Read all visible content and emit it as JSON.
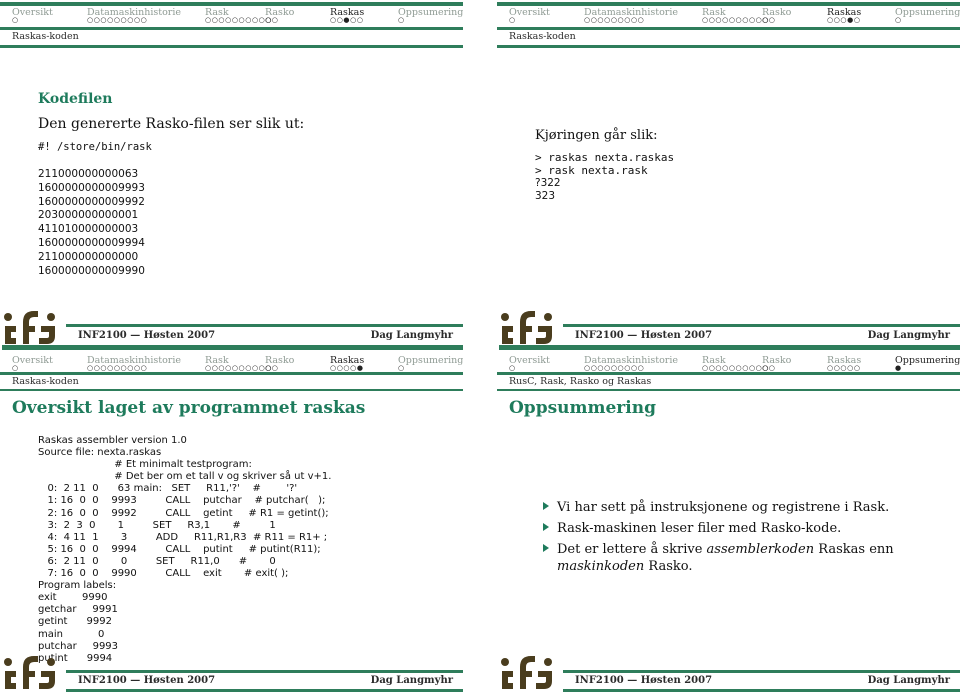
{
  "nav": {
    "sections": [
      {
        "label": "Oversikt",
        "dots": "○"
      },
      {
        "label": "Datamaskinhistorie",
        "dots": "○○○○○○○○○"
      },
      {
        "label": "Rask",
        "dots": "○○○○○○○○○○"
      },
      {
        "label": "Rasko",
        "dots": "○○"
      },
      {
        "label": "Raskas",
        "dots": "○○○○○"
      },
      {
        "label": "Oppsumering",
        "dots": "○"
      }
    ]
  },
  "footer": {
    "course": "INF2100 — Høsten 2007",
    "author": "Dag Langmyhr"
  },
  "slides": [
    {
      "subsection": "Raskas-koden",
      "active_section": "Raskas",
      "dots": [
        "○",
        "○○○○○○○○○",
        "○○○○○○○○○○",
        "○○",
        "○○●○○",
        "○"
      ],
      "block_title": "Kodefilen",
      "intro": "Den genererte Rasko-filen ser slik ut:",
      "shebang": "#! /store/bin/rask",
      "lines": [
        "211000000000063",
        "1600000000009993",
        "1600000000009992",
        "203000000000001",
        "411010000000003",
        "1600000000009994",
        "211000000000000",
        "1600000000009990"
      ]
    },
    {
      "subsection": "Raskas-koden",
      "active_section": "Raskas",
      "dots": [
        "○",
        "○○○○○○○○○",
        "○○○○○○○○○○",
        "○○",
        "○○○●○",
        "○"
      ],
      "intro": "Kjøringen går slik:",
      "terminal": [
        "> raskas nexta.raskas",
        "> rask nexta.rask"
      ],
      "output": [
        "?322",
        "323"
      ]
    },
    {
      "subsection": "Raskas-koden",
      "active_section": "Raskas",
      "dots": [
        "○",
        "○○○○○○○○○",
        "○○○○○○○○○○",
        "○○",
        "○○○○●",
        "○"
      ],
      "frame_title": "Oversikt laget av programmet raskas",
      "listing": [
        "Raskas assembler version 1.0",
        "Source file: nexta.raskas",
        "                        # Et minimalt testprogram:",
        "                        # Det ber om et tall v og skriver så ut v+1.",
        "   0:  2 11  0      63 main:   SET     R11,'?'    #        '?'",
        "   1: 16  0  0    9993         CALL    putchar    # putchar(   );",
        "   2: 16  0  0    9992         CALL    getint     # R1 = getint();",
        "   3:  2  3  0       1         SET     R3,1       #         1",
        "   4:  4 11  1       3         ADD     R11,R1,R3  # R11 = R1+ ;",
        "   5: 16  0  0    9994         CALL    putint     # putint(R11);",
        "   6:  2 11  0       0         SET     R11,0      #       0",
        "   7: 16  0  0    9990         CALL    exit       # exit( );",
        "Program labels:",
        "exit        9990",
        "getchar     9991",
        "getint      9992",
        "main           0",
        "putchar     9993",
        "putint      9994"
      ]
    },
    {
      "subsection": "RusC, Rask, Rasko og Raskas",
      "active_section": "Oppsumering",
      "dots": [
        "○",
        "○○○○○○○○○",
        "○○○○○○○○○○",
        "○○",
        "○○○○○",
        "●"
      ],
      "frame_title": "Oppsummering",
      "bullets": [
        {
          "text": "Vi har sett på instruksjonene og registrene i Rask."
        },
        {
          "text": "Rask-maskinen leser filer med Rasko-kode."
        },
        {
          "pre": "Det er lettere å skrive ",
          "em1": "assemblerkoden",
          "mid": " Raskas enn ",
          "em2": "maskinkoden",
          "post": " Rasko."
        }
      ]
    }
  ],
  "colors": {
    "accent": "#2e7d5b",
    "title": "#1e7b5c",
    "logo": "#4a3d1e"
  }
}
